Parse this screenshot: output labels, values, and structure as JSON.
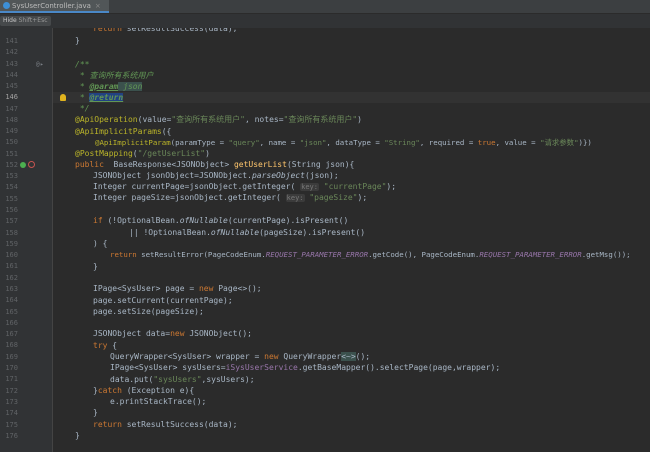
{
  "tab": {
    "title": "SysUserController.java",
    "close": "×"
  },
  "hint_bar": {
    "hide": "Hide",
    "shortcut": "Shift+Esc"
  },
  "top_partial": [
    {
      "t": "}"
    },
    {
      "t": "return setResultSuccess(data);"
    }
  ],
  "lines": [
    {
      "n": "141"
    },
    {
      "n": "142"
    },
    {
      "n": "143"
    },
    {
      "n": "144"
    },
    {
      "n": "145"
    },
    {
      "n": "146"
    },
    {
      "n": "147"
    },
    {
      "n": "148"
    },
    {
      "n": "149"
    },
    {
      "n": "150"
    },
    {
      "n": "151"
    },
    {
      "n": "152"
    },
    {
      "n": "153"
    },
    {
      "n": "154"
    },
    {
      "n": "155"
    },
    {
      "n": "156"
    },
    {
      "n": "157"
    },
    {
      "n": "158"
    },
    {
      "n": "159"
    },
    {
      "n": "160"
    },
    {
      "n": "161"
    },
    {
      "n": "162"
    },
    {
      "n": "163"
    },
    {
      "n": "164"
    },
    {
      "n": "165"
    },
    {
      "n": "166"
    },
    {
      "n": "167"
    },
    {
      "n": "168"
    },
    {
      "n": "169"
    },
    {
      "n": "170"
    },
    {
      "n": "171"
    },
    {
      "n": "172"
    },
    {
      "n": "173"
    },
    {
      "n": "174"
    },
    {
      "n": "175"
    },
    {
      "n": "176"
    }
  ],
  "code": {
    "l141": "}",
    "l143": "/**",
    "l144": " * 查询所有系统用户",
    "l145_a": " * ",
    "l145_tag": "@param",
    "l145_b": " json",
    "l146_a": " * ",
    "l146_tag": "@return",
    "l147": " */",
    "l148_ann": "@ApiOperation",
    "l148_a": "(value=",
    "l148_s1": "\"查询所有系统用户\"",
    "l148_b": ", notes=",
    "l148_s2": "\"查询所有系统用户\"",
    "l148_c": ")",
    "l149_ann": "@ApiImplicitParams",
    "l149_a": "({",
    "l150_ann": "@ApiImplicitParam",
    "l150_a": "(paramType = ",
    "l150_s1": "\"query\"",
    "l150_b": ", name = ",
    "l150_s2": "\"json\"",
    "l150_c": ", dataType = ",
    "l150_s3": "\"String\"",
    "l150_d": ", required = ",
    "l150_k": "true",
    "l150_e": ", value = ",
    "l150_s4": "\"请求参数\"",
    "l150_f": ")})",
    "l151_ann": "@PostMapping",
    "l151_a": "(",
    "l151_s": "\"/getUserList\"",
    "l151_b": ")",
    "l152_kw": "public",
    "l152_a": "  BaseResponse<JSONObject> ",
    "l152_fn": "getUserList",
    "l152_b": "(String json){",
    "l153_a": "JSONObject jsonObject=JSONObject.",
    "l153_it": "parseObject",
    "l153_b": "(json);",
    "l154_a": "Integer currentPage=jsonObject.getInteger( ",
    "l154_hint": "key:",
    "l154_s": " \"currentPage\"",
    "l154_b": ");",
    "l155_a": "Integer pageSize=jsonObject.getInteger( ",
    "l155_hint": "key:",
    "l155_s": " \"pageSize\"",
    "l155_b": ");",
    "l157_kw": "if",
    "l157_a": " (!OptionalBean.",
    "l157_it": "ofNullable",
    "l157_b": "(currentPage).isPresent()",
    "l158_a": "|| !OptionalBean.",
    "l158_it": "ofNullable",
    "l158_b": "(pageSize).isPresent()",
    "l159": ") {",
    "l160_kw": "return",
    "l160_a": " setResultError(PageCodeEnum.",
    "l160_c1": "REQUEST_PARAMETER_ERROR",
    "l160_b": ".getCode(), PageCodeEnum.",
    "l160_c2": "REQUEST_PARAMETER_ERROR",
    "l160_c": ".getMsg());",
    "l161": "}",
    "l163_a": "IPage<SysUser> page = ",
    "l163_kw": "new",
    "l163_b": " Page<>();",
    "l164": "page.setCurrent(currentPage);",
    "l165": "page.setSize(pageSize);",
    "l167_a": "JSONObject data=",
    "l167_kw": "new",
    "l167_b": " JSONObject();",
    "l168_kw": "try",
    "l168_a": " {",
    "l169_a": "QueryWrapper<SysUser> wrapper = ",
    "l169_kw": "new",
    "l169_b": " QueryWrapper",
    "l169_g": "<~>",
    "l169_c": "();",
    "l170_a": "IPage<SysUser> sysUsers=",
    "l170_f": "iSysUserService",
    "l170_b": ".getBaseMapper().selectPage(page,wrapper);",
    "l171_a": "data.put(",
    "l171_s": "\"sysUsers\"",
    "l171_b": ",sysUsers);",
    "l172_a": "}",
    "l172_kw": "catch",
    "l172_b": " (Exception e){",
    "l173": "e.printStackTrace();",
    "l174": "}",
    "l175_kw": "return",
    "l175_a": " setResultSuccess(data);",
    "l176": "}"
  },
  "gutter_markers": {
    "m143": "@",
    "m152": "◐"
  },
  "colors": {
    "background": "#2b2b2b",
    "keyword": "#cc7832",
    "string": "#6a8759",
    "annotation": "#bbb529",
    "doc": "#629755",
    "method": "#ffc66d",
    "constant": "#9876aa"
  }
}
